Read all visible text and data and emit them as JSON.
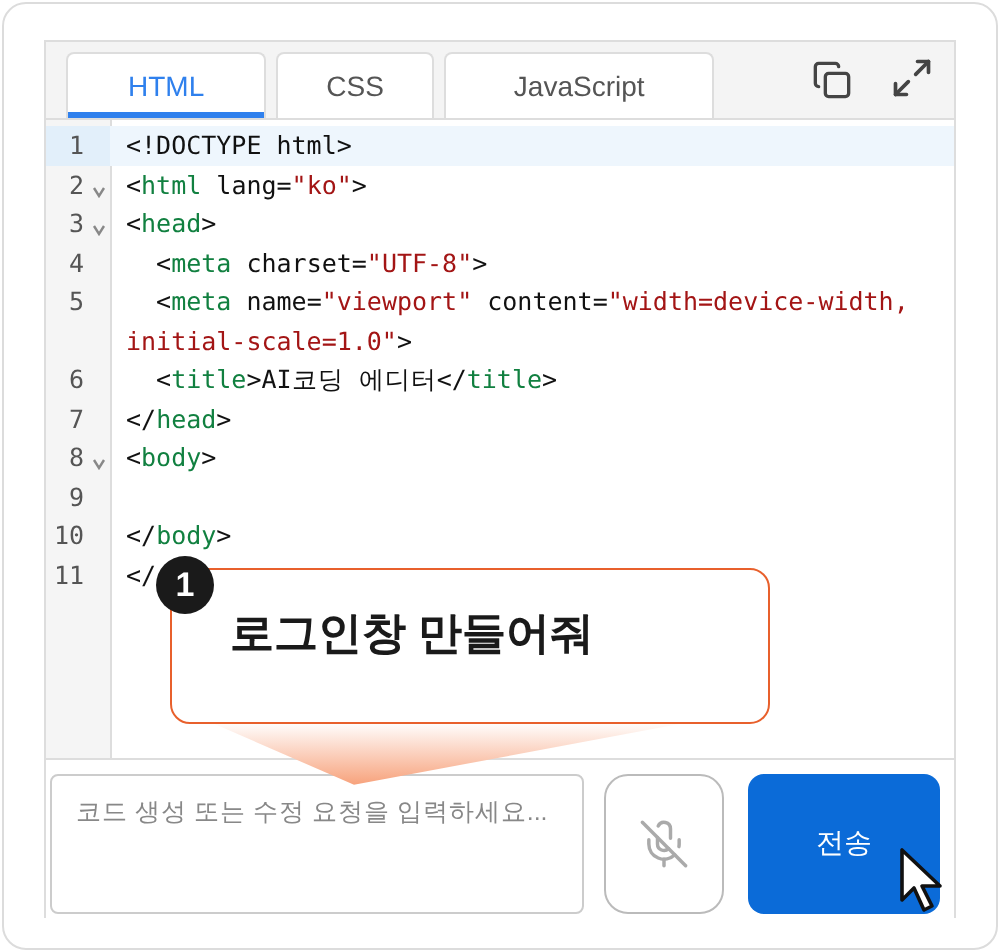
{
  "tabs": [
    {
      "label": "HTML",
      "selected": true
    },
    {
      "label": "CSS",
      "selected": false
    },
    {
      "label": "JavaScript",
      "selected": false
    }
  ],
  "code_lines": [
    {
      "number": "1",
      "fold": false,
      "active": true,
      "segments": [
        {
          "kind": "punct",
          "text": "<!DOCTYPE html>"
        }
      ]
    },
    {
      "number": "2",
      "fold": true,
      "active": false,
      "segments": [
        {
          "kind": "punct",
          "text": "<"
        },
        {
          "kind": "tag",
          "text": "html"
        },
        {
          "kind": "attr",
          "text": " lang="
        },
        {
          "kind": "string",
          "text": "\"ko\""
        },
        {
          "kind": "punct",
          "text": ">"
        }
      ]
    },
    {
      "number": "3",
      "fold": true,
      "active": false,
      "segments": [
        {
          "kind": "punct",
          "text": "<"
        },
        {
          "kind": "tag",
          "text": "head"
        },
        {
          "kind": "punct",
          "text": ">"
        }
      ]
    },
    {
      "number": "4",
      "fold": false,
      "active": false,
      "segments": [
        {
          "kind": "punct",
          "text": "  <"
        },
        {
          "kind": "tag",
          "text": "meta"
        },
        {
          "kind": "attr",
          "text": " charset="
        },
        {
          "kind": "string",
          "text": "\"UTF-8\""
        },
        {
          "kind": "punct",
          "text": ">"
        }
      ]
    },
    {
      "number": "5",
      "fold": false,
      "active": false,
      "segments": [
        {
          "kind": "punct",
          "text": "  <"
        },
        {
          "kind": "tag",
          "text": "meta"
        },
        {
          "kind": "attr",
          "text": " name="
        },
        {
          "kind": "string",
          "text": "\"viewport\""
        },
        {
          "kind": "attr",
          "text": " content="
        },
        {
          "kind": "string",
          "text": "\"width=device-width,"
        }
      ]
    },
    {
      "fold": false,
      "active": false,
      "segments": [
        {
          "kind": "string",
          "text": "initial-scale=1.0\""
        },
        {
          "kind": "punct",
          "text": ">"
        }
      ]
    },
    {
      "number": "6",
      "fold": false,
      "active": false,
      "segments": [
        {
          "kind": "punct",
          "text": "  <"
        },
        {
          "kind": "tag",
          "text": "title"
        },
        {
          "kind": "punct",
          "text": ">AI코딩 에디터</"
        },
        {
          "kind": "tag",
          "text": "title"
        },
        {
          "kind": "punct",
          "text": ">"
        }
      ]
    },
    {
      "number": "7",
      "fold": false,
      "active": false,
      "segments": [
        {
          "kind": "punct",
          "text": "</"
        },
        {
          "kind": "tag",
          "text": "head"
        },
        {
          "kind": "punct",
          "text": ">"
        }
      ]
    },
    {
      "number": "8",
      "fold": true,
      "active": false,
      "segments": [
        {
          "kind": "punct",
          "text": "<"
        },
        {
          "kind": "tag",
          "text": "body"
        },
        {
          "kind": "punct",
          "text": ">"
        }
      ]
    },
    {
      "number": "9",
      "fold": false,
      "active": false
    },
    {
      "number": "10",
      "fold": false,
      "active": false,
      "segments": [
        {
          "kind": "punct",
          "text": "</"
        },
        {
          "kind": "tag",
          "text": "body"
        },
        {
          "kind": "punct",
          "text": ">"
        }
      ]
    },
    {
      "number": "11",
      "fold": false,
      "active": false,
      "segments": [
        {
          "kind": "punct",
          "text": "</"
        }
      ]
    }
  ],
  "callout": {
    "step": "1",
    "text": "로그인창 만들어줘"
  },
  "prompt": {
    "placeholder": "코드 생성 또는 수정 요청을 입력하세요..."
  },
  "send_button": "전송"
}
